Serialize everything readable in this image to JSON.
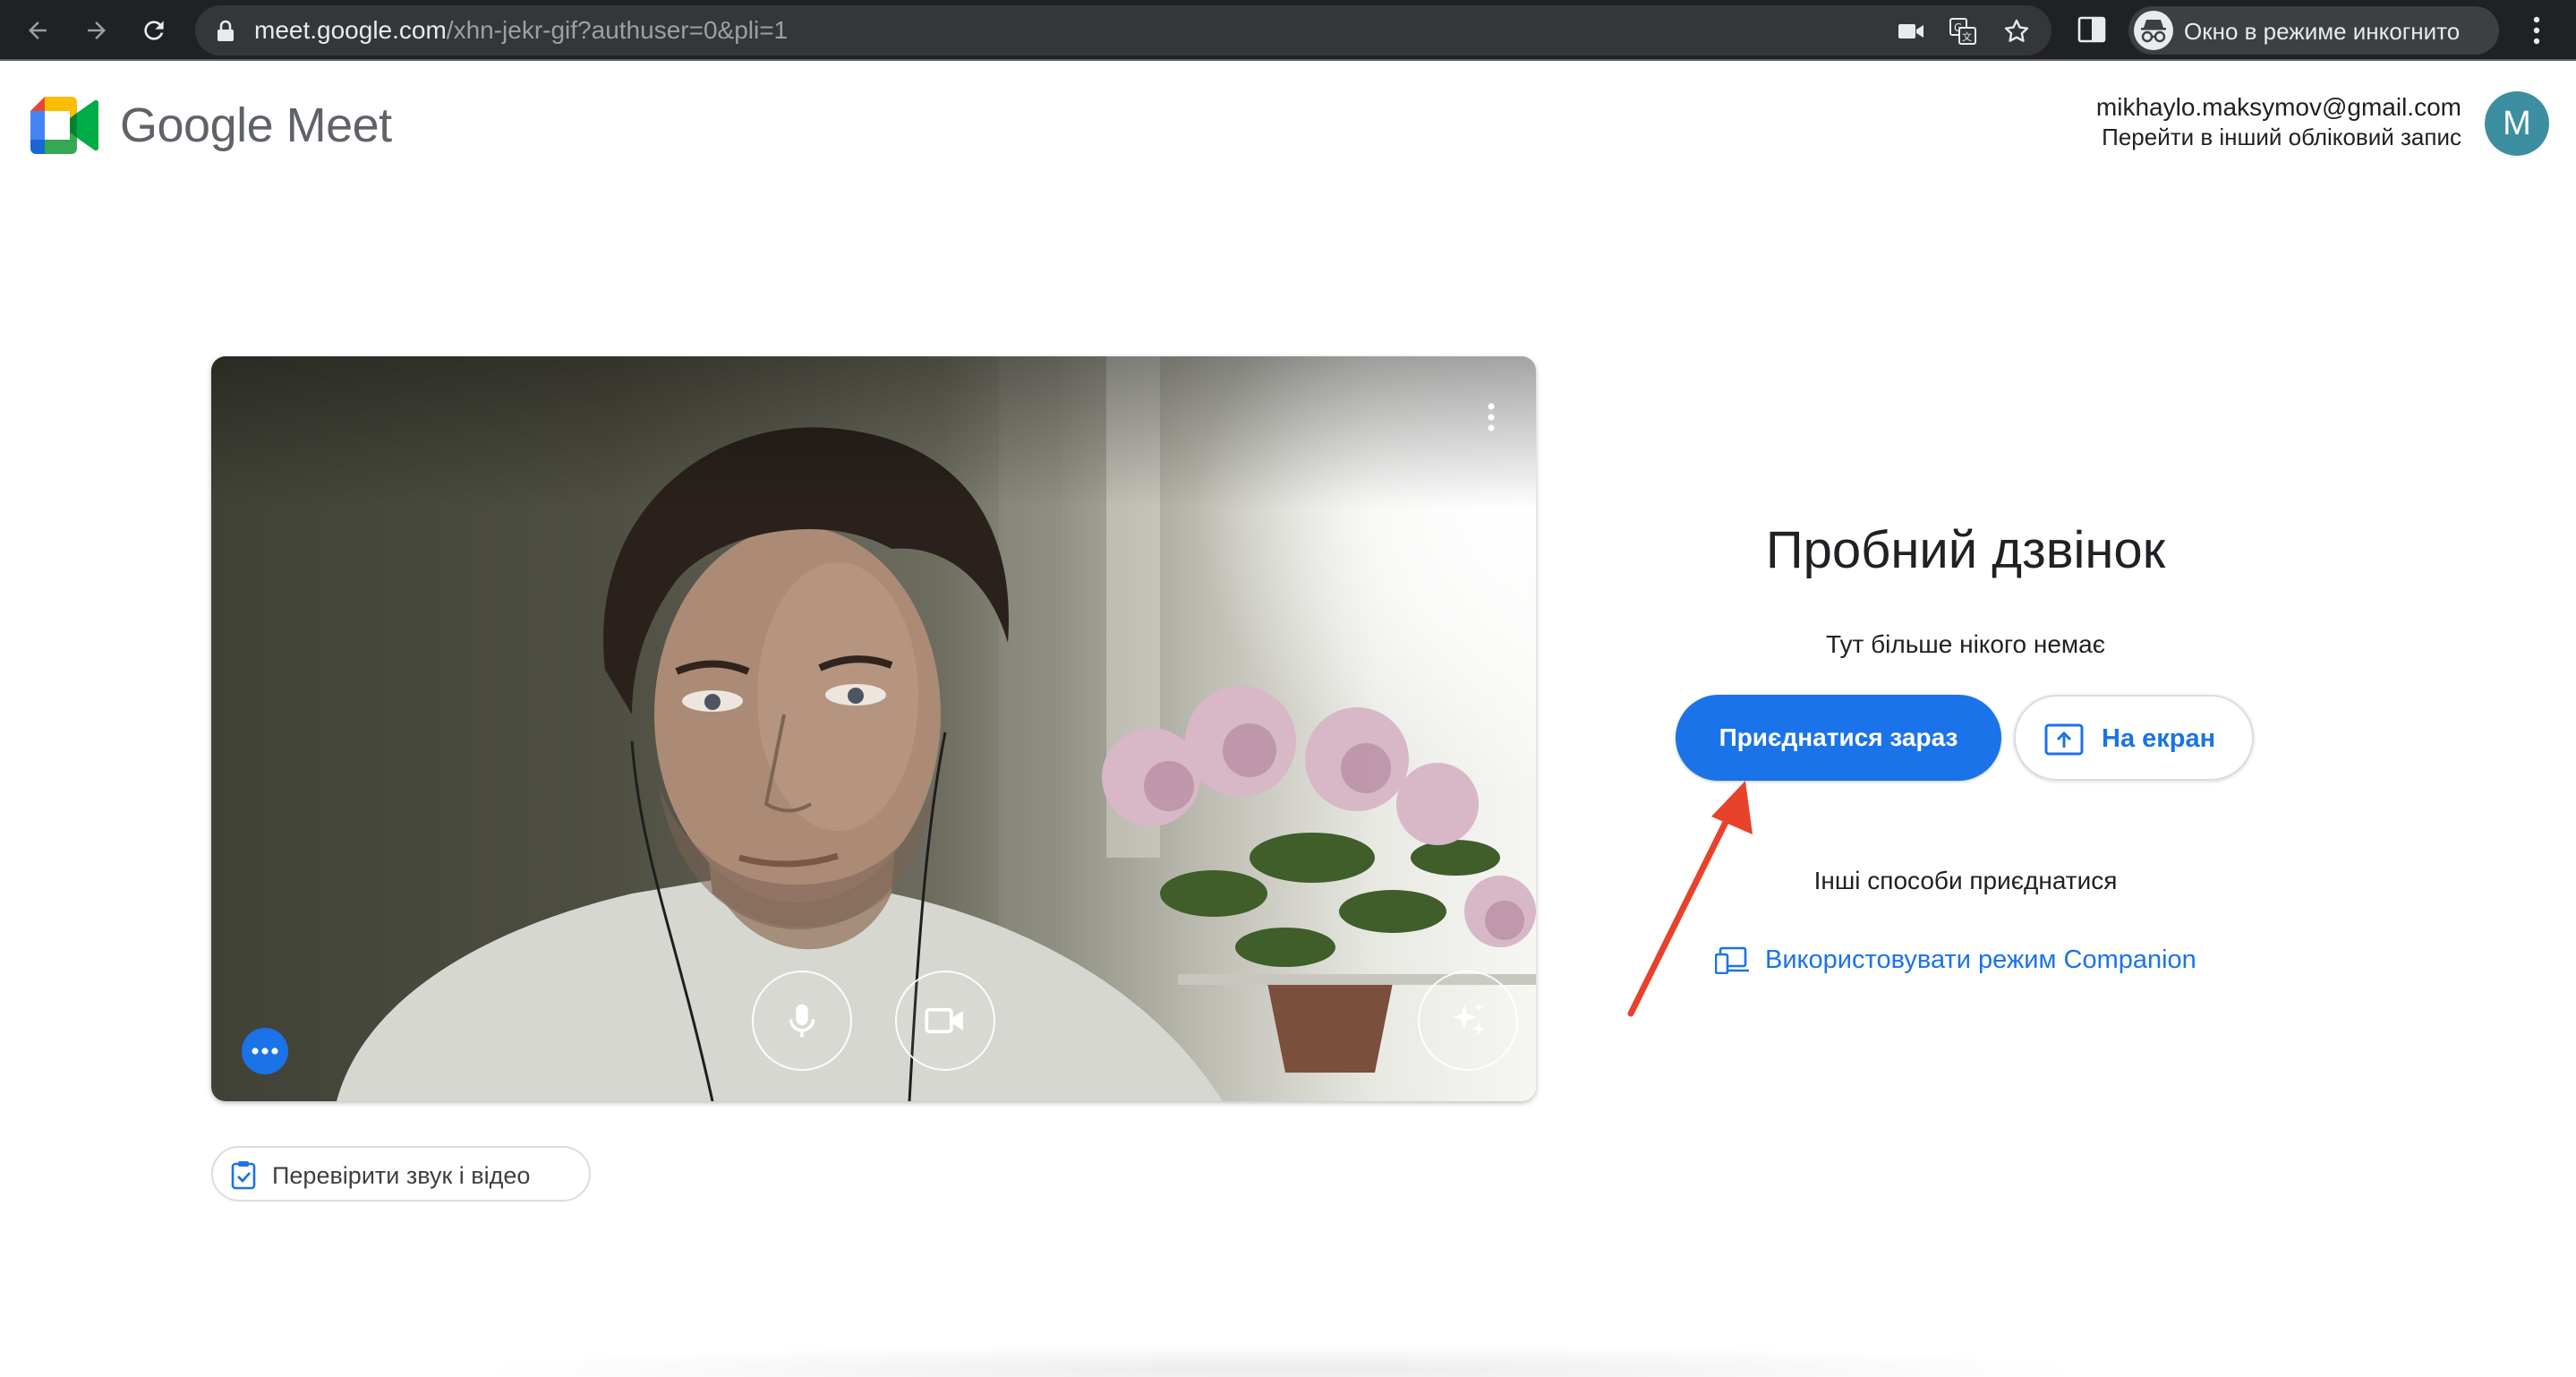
{
  "browser": {
    "url_host": "meet.google.com",
    "url_path": "/xhn-jekr-gif?authuser=0&pli=1",
    "incognito_label": "Окно в режиме инкогнито",
    "icons": [
      "back-arrow-icon",
      "forward-arrow-icon",
      "reload-icon",
      "lock-icon",
      "camera-icon",
      "translate-icon",
      "star-icon",
      "side-panel-icon",
      "incognito-icon",
      "more-vert-icon"
    ]
  },
  "header": {
    "product_name": "Google Meet",
    "account_email": "mikhaylo.maksymov@gmail.com",
    "switch_account": "Перейти в інший обліковий запис",
    "avatar_initial": "M",
    "avatar_color": "#3c8fa0"
  },
  "preview": {
    "check_av_label": "Перевірити звук і відео",
    "controls": [
      "microphone-icon",
      "camera-icon",
      "visual-effects-icon",
      "more-options-icon"
    ]
  },
  "join": {
    "title": "Пробний дзвінок",
    "status": "Тут більше нікого немає",
    "join_button": "Приєднатися зараз",
    "present_button": "На екран",
    "other_ways": "Інші способи приєднатися",
    "companion_link": "Використовувати режим Companion"
  },
  "colors": {
    "accent": "#1a73e8",
    "annotation_arrow": "#e8412c",
    "chrome_bg": "#202124"
  }
}
